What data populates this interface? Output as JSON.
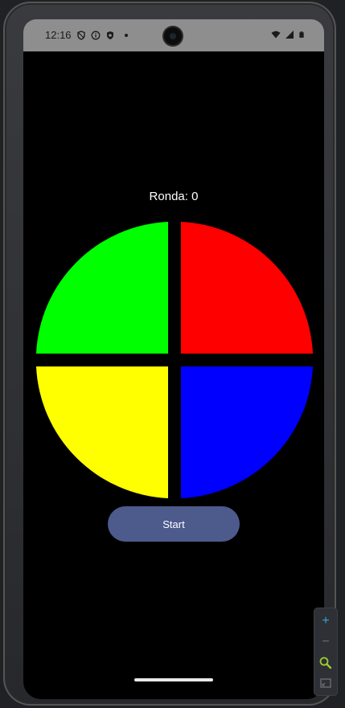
{
  "status_bar": {
    "time": "12:16",
    "left_icons": [
      "shield-icon",
      "info-icon",
      "shield-check-icon",
      "dot-icon"
    ],
    "right_icons": [
      "wifi-icon",
      "signal-icon",
      "battery-icon"
    ]
  },
  "game": {
    "round_label": "Ronda: 0",
    "quadrants": [
      {
        "name": "green",
        "color": "#00ff00"
      },
      {
        "name": "red",
        "color": "#ff0000"
      },
      {
        "name": "yellow",
        "color": "#ffff00"
      },
      {
        "name": "blue",
        "color": "#0000ff"
      }
    ],
    "start_label": "Start",
    "start_color": "#4d5a8c"
  },
  "emulator_controls": {
    "zoom_in": "+",
    "zoom_out": "−",
    "icons": [
      "zoom-in-icon",
      "zoom-out-icon",
      "magnifier-icon",
      "fit-screen-icon"
    ]
  }
}
